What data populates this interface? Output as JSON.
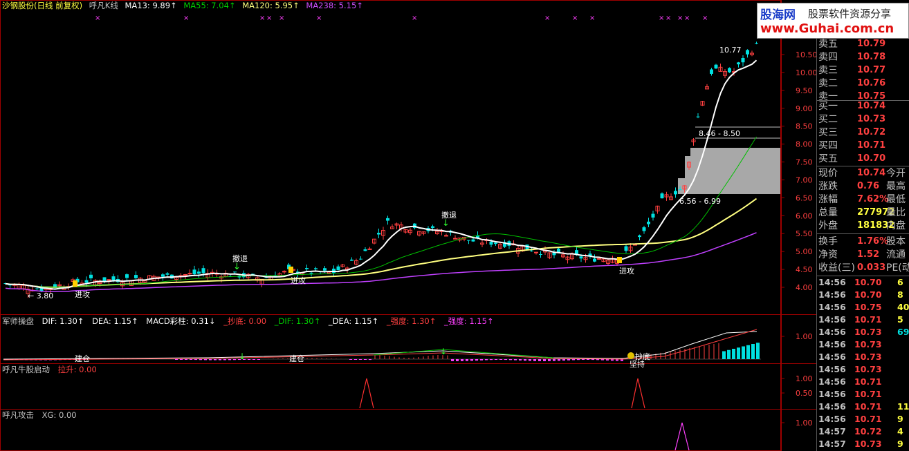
{
  "header": {
    "stock": "沙钢股份(日线 前复权)",
    "indicator": "呼凡K线",
    "ma13": "MA13: 9.89↑",
    "ma55": "MA55: 7.04↑",
    "ma120": "MA120: 5.95↑",
    "ma238": "MA238: 5.15↑"
  },
  "logo": {
    "name": "股海网",
    "slogan": "股票软件资源分享",
    "url": "www.Guhai.com.cn"
  },
  "price_axis": [
    "10.50",
    "10.00",
    "9.50",
    "9.00",
    "8.50",
    "8.00",
    "7.50",
    "7.00",
    "6.50",
    "6.00",
    "5.50",
    "5.00",
    "4.50",
    "4.00"
  ],
  "annotations": {
    "low": "← 3.80",
    "high": "10.77",
    "range1": "8.46 - 8.50",
    "range2": "6.56 - 6.99",
    "jingong": "进攻",
    "chetui": "撤退"
  },
  "macd_panel": {
    "name": "军师操盘",
    "dif": "DIF: 1.30↑",
    "dea": "DEA: 1.15↑",
    "macd": "MACD彩柱: 0.31↓",
    "chaodi": "_抄底: 0.00",
    "dif2": "_DIF: 1.30↑",
    "dea2": "_DEA: 1.15↑",
    "qiangdu1": "_强度: 1.30↑",
    "qiangdu2": "_强度: 1.15↑",
    "axis": "1.00",
    "jiancang": "建仓",
    "chaodi_tag": "抄底",
    "jianchi": "坚持"
  },
  "niugu_panel": {
    "name": "呼凡牛股启动",
    "value": "拉升: 0.00",
    "axis1": "1.00",
    "axis2": "0.50"
  },
  "gongji_panel": {
    "name": "呼凡攻击",
    "value": "XG: 0.00",
    "axis1": "1.00"
  },
  "order_book": {
    "asks": [
      {
        "label": "卖五",
        "price": "10.79"
      },
      {
        "label": "卖四",
        "price": "10.78"
      },
      {
        "label": "卖三",
        "price": "10.77"
      },
      {
        "label": "卖二",
        "price": "10.76"
      },
      {
        "label": "卖一",
        "price": "10.75"
      }
    ],
    "bids": [
      {
        "label": "买一",
        "price": "10.74"
      },
      {
        "label": "买二",
        "price": "10.73"
      },
      {
        "label": "买三",
        "price": "10.72"
      },
      {
        "label": "买四",
        "price": "10.71"
      },
      {
        "label": "买五",
        "price": "10.70"
      }
    ]
  },
  "quote": [
    {
      "label": "现价",
      "value": "10.74",
      "label2": "今开"
    },
    {
      "label": "涨跌",
      "value": "0.76",
      "label2": "最高"
    },
    {
      "label": "涨幅",
      "value": "7.62%",
      "label2": "最低"
    },
    {
      "label": "总量",
      "value": "277972",
      "label2": "量比"
    },
    {
      "label": "外盘",
      "value": "181832",
      "label2": "内盘"
    },
    {
      "label": "换手",
      "value": "1.76%",
      "label2": "股本"
    },
    {
      "label": "净资",
      "value": "1.52",
      "label2": "流通"
    },
    {
      "label": "收益(三)",
      "value": "0.033",
      "label2": "PE(动"
    }
  ],
  "ticks": [
    {
      "time": "14:56",
      "price": "10.70",
      "vol": "6"
    },
    {
      "time": "14:56",
      "price": "10.70",
      "vol": "8"
    },
    {
      "time": "14:56",
      "price": "10.75",
      "vol": "40"
    },
    {
      "time": "14:56",
      "price": "10.71",
      "vol": "5"
    },
    {
      "time": "14:56",
      "price": "10.73",
      "vol": "69"
    },
    {
      "time": "14:56",
      "price": "10.73",
      "vol": ""
    },
    {
      "time": "14:56",
      "price": "10.73",
      "vol": ""
    },
    {
      "time": "14:56",
      "price": "10.73",
      "vol": ""
    },
    {
      "time": "14:56",
      "price": "10.71",
      "vol": ""
    },
    {
      "time": "14:56",
      "price": "10.71",
      "vol": ""
    },
    {
      "time": "14:56",
      "price": "10.71",
      "vol": "11"
    },
    {
      "time": "14:56",
      "price": "10.71",
      "vol": "9"
    },
    {
      "time": "14:57",
      "price": "10.72",
      "vol": "4"
    },
    {
      "time": "14:57",
      "price": "10.73",
      "vol": "9"
    }
  ],
  "colors": {
    "up": "#ff4040",
    "down": "#00e0e0",
    "ma13": "#ffffff",
    "ma55": "#00c000",
    "ma120": "#ffff80",
    "ma238": "#c040ff",
    "grid": "#800000"
  }
}
